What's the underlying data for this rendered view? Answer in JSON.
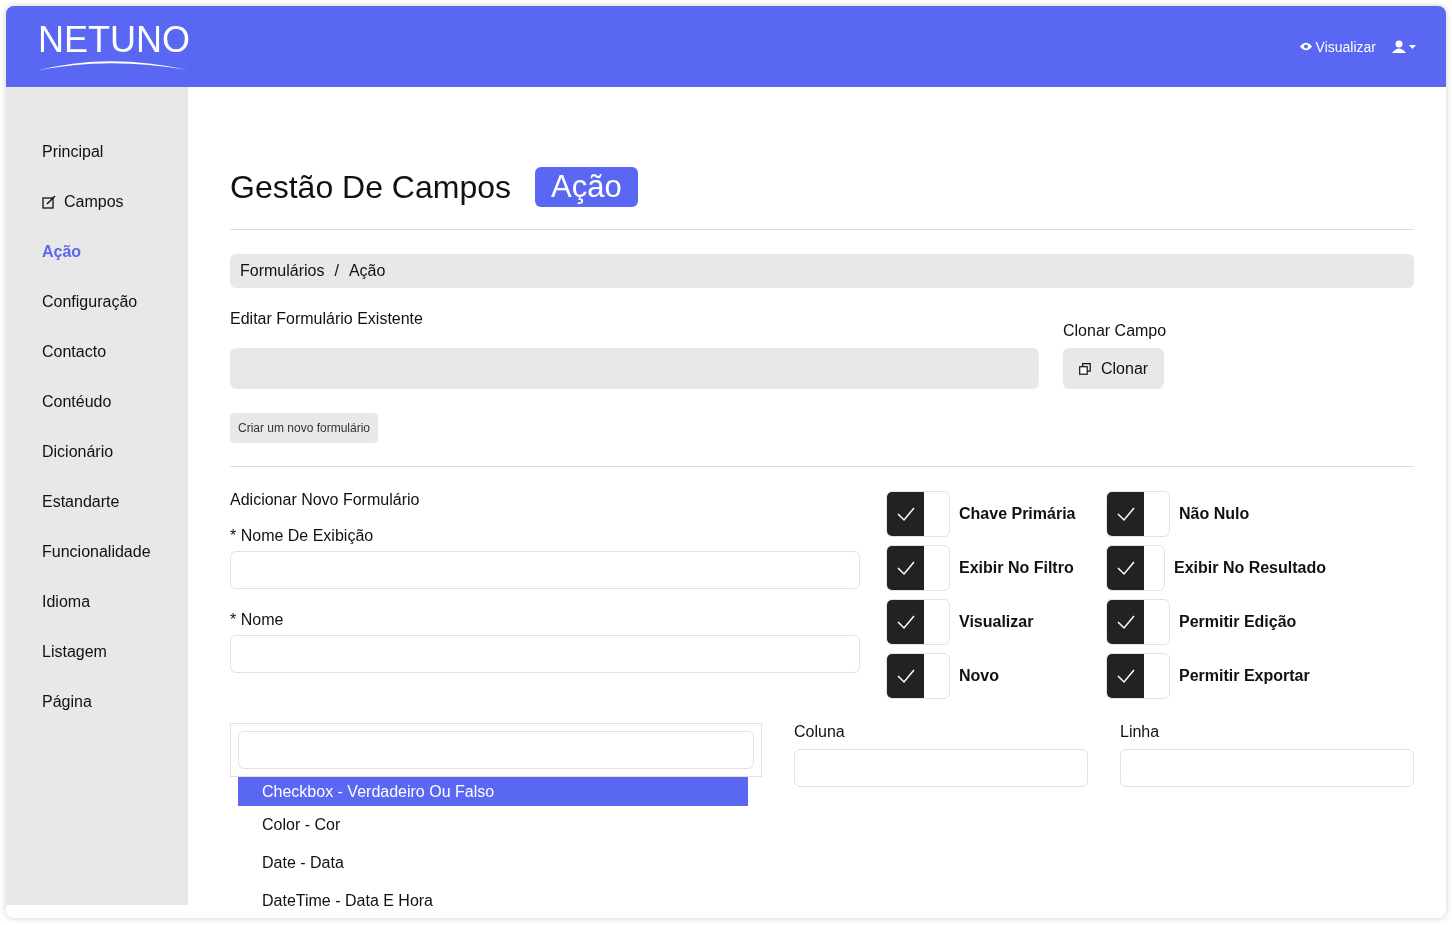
{
  "header": {
    "logo": "NETUNO",
    "view_link": "Visualizar"
  },
  "sidebar": {
    "items": [
      {
        "label": "Principal",
        "icon": false,
        "selected": false
      },
      {
        "label": "Campos",
        "icon": true,
        "selected": false
      },
      {
        "label": "Ação",
        "icon": false,
        "selected": true
      },
      {
        "label": "Configuração",
        "icon": false,
        "selected": false
      },
      {
        "label": "Contacto",
        "icon": false,
        "selected": false
      },
      {
        "label": "Contéudo",
        "icon": false,
        "selected": false
      },
      {
        "label": "Dicionário",
        "icon": false,
        "selected": false
      },
      {
        "label": "Estandarte",
        "icon": false,
        "selected": false
      },
      {
        "label": "Funcionalidade",
        "icon": false,
        "selected": false
      },
      {
        "label": "Idioma",
        "icon": false,
        "selected": false
      },
      {
        "label": "Listagem",
        "icon": false,
        "selected": false
      },
      {
        "label": "Página",
        "icon": false,
        "selected": false
      }
    ]
  },
  "page": {
    "title": "Gestão De Campos",
    "badge": "Ação"
  },
  "breadcrumb": {
    "items": [
      "Formulários",
      "Ação"
    ],
    "separator": "/"
  },
  "edit_section": {
    "label": "Editar Formulário Existente",
    "clone_label": "Clonar Campo",
    "clone_button": "Clonar",
    "create_button": "Criar um novo formulário"
  },
  "new_form": {
    "title": "Adicionar Novo Formulário",
    "display_name_label": "* Nome De Exibição",
    "name_label": "* Nome"
  },
  "toggles": [
    {
      "label": "Chave Primária",
      "checked": true
    },
    {
      "label": "Não Nulo",
      "checked": true
    },
    {
      "label": "Exibir No Filtro",
      "checked": true
    },
    {
      "label": "Exibir No Resultado",
      "checked": true
    },
    {
      "label": "Visualizar",
      "checked": true
    },
    {
      "label": "Permitir Edição",
      "checked": true
    },
    {
      "label": "Novo",
      "checked": true
    },
    {
      "label": "Permitir Exportar",
      "checked": true
    }
  ],
  "type_dropdown": {
    "options": [
      {
        "label": "Checkbox - Verdadeiro Ou Falso",
        "selected": true
      },
      {
        "label": "Color - Cor",
        "selected": false
      },
      {
        "label": "Date - Data",
        "selected": false
      },
      {
        "label": "DateTime - Data E Hora",
        "selected": false
      }
    ]
  },
  "column_label": "Coluna",
  "row_label": "Linha"
}
